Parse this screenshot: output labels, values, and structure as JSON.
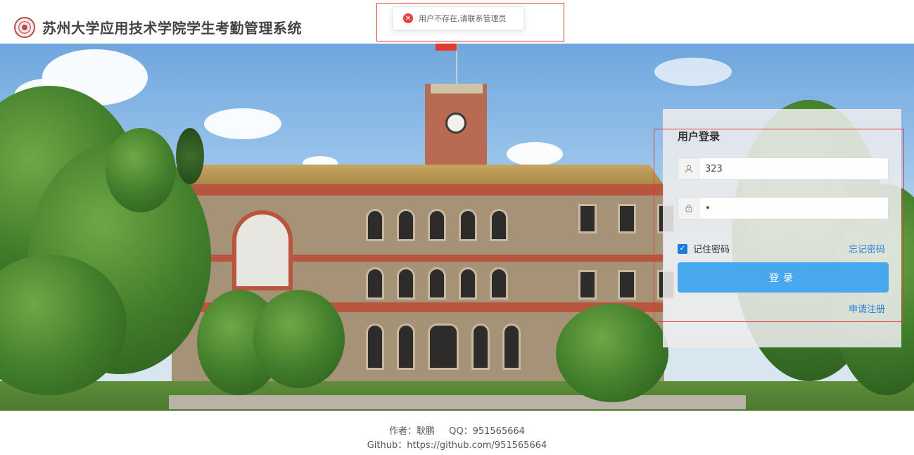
{
  "header": {
    "title": "苏州大学应用技术学院学生考勤管理系统"
  },
  "toast": {
    "message": "用户不存在,请联系管理员",
    "icon": "error-circle-icon",
    "color": "#e64242"
  },
  "login": {
    "title": "用户登录",
    "username_value": "323",
    "password_value": "1",
    "remember_label": "记住密码",
    "remember_checked": true,
    "forgot_label": "忘记密码",
    "submit_label": "登录",
    "register_label": "申请注册",
    "accent_color": "#48a8ee"
  },
  "footer": {
    "author": "作者：耿鹏",
    "qq": "QQ：951565664",
    "github": "Github：https://github.com/951565664"
  }
}
